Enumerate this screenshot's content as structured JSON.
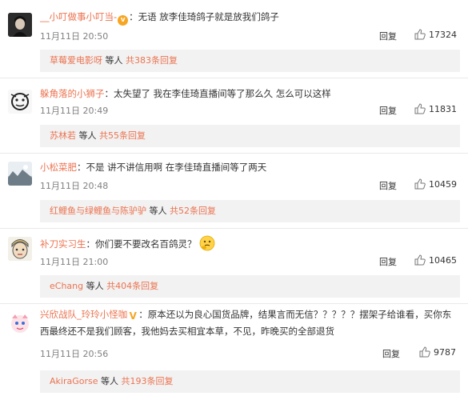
{
  "comments": [
    {
      "username": "__小叮做事小叮当-",
      "text": "：无语 放李佳琦鸽子就是放我们鸽子",
      "time": "11月11日 20:50",
      "reply_label": "回复",
      "likes": "17324",
      "sub_names": "草莓爱电影呀",
      "sub_mid": " 等人 ",
      "sub_more": "共383条回复"
    },
    {
      "username": "躲角落的小狮子",
      "text": "：太失望了 我在李佳琦直播间等了那么久 怎么可以这样",
      "time": "11月11日 20:49",
      "reply_label": "回复",
      "likes": "11831",
      "sub_names": "苏林若",
      "sub_mid": " 等人 ",
      "sub_more": "共55条回复"
    },
    {
      "username": "小松菜肥",
      "text": "：不是 讲不讲信用啊 在李佳琦直播间等了两天",
      "time": "11月11日 20:48",
      "reply_label": "回复",
      "likes": "10459",
      "sub_names": "红鲤鱼与绿鲤鱼与陈驴驴",
      "sub_mid": " 等人 ",
      "sub_more": "共52条回复"
    },
    {
      "username": "补刀实习生",
      "text": "：你们要不要改名百鸽灵？",
      "time": "11月11日 21:00",
      "reply_label": "回复",
      "likes": "10465",
      "sub_names": "eChang",
      "sub_mid": " 等人 ",
      "sub_more": "共404条回复"
    },
    {
      "username": "兴欣战队_玲玲小怪咖",
      "text": "：原本还以为良心国货品牌，结果言而无信？？？？？摆架子给谁看，买你东西最终还不是我们顾客，我他妈去买相宜本草，不见，昨晚买的全部退货",
      "time": "11月11日 20:56",
      "reply_label": "回复",
      "likes": "9787",
      "sub_names": "AkiraGorse",
      "sub_mid": " 等人 ",
      "sub_more": "共193条回复"
    }
  ],
  "colors": {
    "username": "#eb7350",
    "subreply_bg": "#f2f2f2",
    "time": "#808080"
  },
  "icons": {
    "like": "thumbs-up-icon",
    "badge_user1": "member-badge-icon",
    "badge_user5": "verified-v-icon",
    "emoji": "thinking-face-emoji"
  }
}
